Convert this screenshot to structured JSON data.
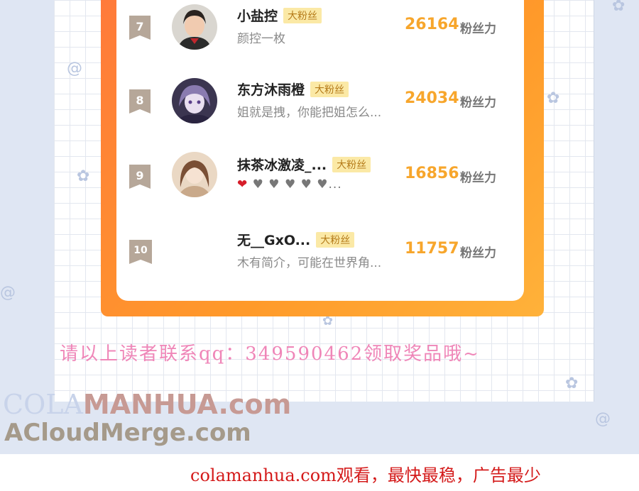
{
  "rows": [
    {
      "rank": "7",
      "name": "小盐控",
      "badge": "大粉丝",
      "desc": "颜控一枚",
      "score": "26164",
      "unit": "粉丝力",
      "avatar": "girl-portrait-avatar"
    },
    {
      "rank": "8",
      "name": "东方沐雨橙",
      "badge": "大粉丝",
      "desc": "姐就是拽，你能把姐怎么...",
      "score": "24034",
      "unit": "粉丝力",
      "avatar": "anime-purple-avatar"
    },
    {
      "rank": "9",
      "name": "抹茶冰激凌_...",
      "badge": "大粉丝",
      "hearts_red": "❤",
      "hearts_grey": "♥ ♥ ♥ ♥ ♥...",
      "score": "16856",
      "unit": "粉丝力",
      "avatar": "illustrated-girl-avatar"
    },
    {
      "rank": "10",
      "name": "无__GxO...",
      "badge": "大粉丝",
      "desc": "木有简介，可能在世界角...",
      "score": "11757",
      "unit": "粉丝力",
      "avatar": ""
    }
  ],
  "contact_text": "请以上读者联系qq：349590462领取奖品哦~",
  "watermark": {
    "line1_a": "COLA",
    "line1_b": "MANHUA.com",
    "line2": "ACloudMerge.com"
  },
  "footer_text": "colamanhua.com观看，最快最稳，广告最少",
  "colors": {
    "frame": "#ff8a30",
    "score": "#f7a62c",
    "badge_bg": "#fbe9a6",
    "footer": "#d41a1a",
    "contact": "#ef86b8"
  }
}
